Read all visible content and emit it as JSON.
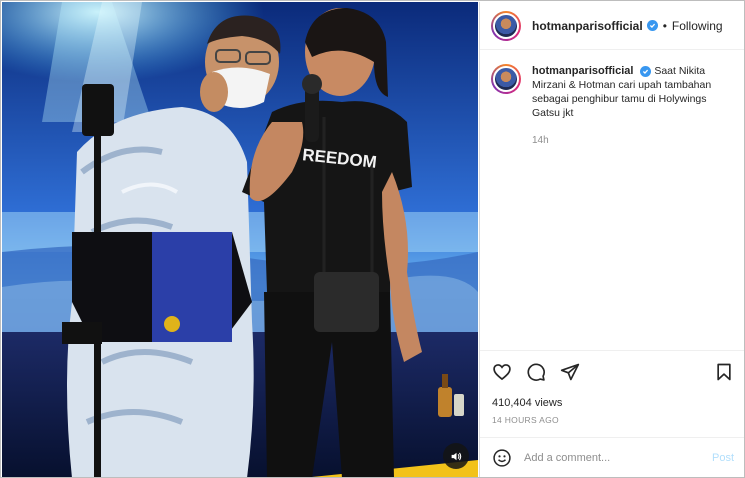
{
  "post": {
    "author": {
      "username": "hotmanparisofficial",
      "verified": true,
      "follow_status": "Following",
      "separator": "•"
    },
    "caption": {
      "username": "hotmanparisofficial",
      "text": "Saat Nikita Mirzani & Hotman cari upah tambahan sebagai penghibur tamu di Holywings Gatsu jkt",
      "relative_time": "14h"
    },
    "media": {
      "type": "video",
      "shirt_text": "REEDOM",
      "sound_icon": "speaker-icon"
    },
    "actions": {
      "like_icon": "heart-icon",
      "comment_icon": "comment-icon",
      "share_icon": "send-icon",
      "save_icon": "bookmark-icon"
    },
    "views": "410,404 views",
    "posted_time": "14 HOURS AGO",
    "comment": {
      "emoji_icon": "emoji-icon",
      "placeholder": "Add a comment...",
      "value": "",
      "post_label": "Post"
    }
  },
  "colors": {
    "verified_blue": "#3897f0",
    "post_button_disabled": "#b2dffc",
    "muted_text": "#8e8e8e",
    "border": "#dbdbdb"
  }
}
